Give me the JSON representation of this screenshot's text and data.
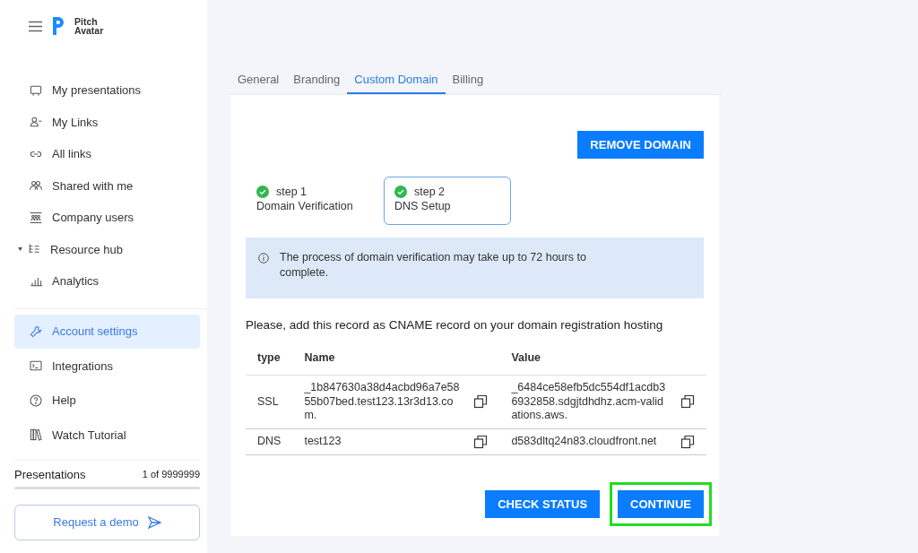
{
  "logo": {
    "line1": "Pitch",
    "line2": "Avatar"
  },
  "sidebar": {
    "items": [
      {
        "label": "My presentations",
        "kind": "link",
        "selected": false
      },
      {
        "label": "My Links",
        "kind": "link",
        "selected": false
      },
      {
        "label": "All links",
        "kind": "link",
        "selected": false
      },
      {
        "label": "Shared with me",
        "kind": "link",
        "selected": false
      },
      {
        "label": "Company users",
        "kind": "link",
        "selected": false
      },
      {
        "label": "Resource hub",
        "kind": "group",
        "selected": false
      },
      {
        "label": "Analytics",
        "kind": "link",
        "selected": false
      }
    ],
    "bottom_items": [
      {
        "label": "Account settings",
        "selected": true
      },
      {
        "label": "Integrations",
        "selected": false
      },
      {
        "label": "Help",
        "selected": false
      },
      {
        "label": "Watch Tutorial",
        "selected": false
      }
    ],
    "usage": {
      "label": "Presentations",
      "count": "1 of 9999999"
    },
    "demo_button": "Request a demo"
  },
  "tabs": [
    {
      "label": "General",
      "selected": false
    },
    {
      "label": "Branding",
      "selected": false
    },
    {
      "label": "Custom Domain",
      "selected": true
    },
    {
      "label": "Billing",
      "selected": false
    }
  ],
  "remove_button": "REMOVE DOMAIN",
  "steps": [
    {
      "step": "step 1",
      "title": "Domain Verification",
      "done": true,
      "selected": false
    },
    {
      "step": "step 2",
      "title": "DNS Setup",
      "done": true,
      "selected": true
    }
  ],
  "notice": "The process of domain verification may take up to 72 hours to complete.",
  "instruction": "Please, add this record as CNAME record on your domain registration hosting",
  "table": {
    "columns": [
      "type",
      "Name",
      "Value"
    ],
    "rows": [
      {
        "type": "SSL",
        "name": "_1b847630a38d4acbd96a7e5855b07bed.test123.13r3d13.com.",
        "value": "_6484ce58efb5dc554df1acdb36932858.sdgjtdhdhz.acm-validations.aws."
      },
      {
        "type": "DNS",
        "name": "test123",
        "value": "d583dltq24n83.cloudfront.net"
      }
    ]
  },
  "buttons": [
    {
      "label": "CHECK STATUS",
      "highlighted": false
    },
    {
      "label": "CONTINUE",
      "highlighted": true
    }
  ]
}
